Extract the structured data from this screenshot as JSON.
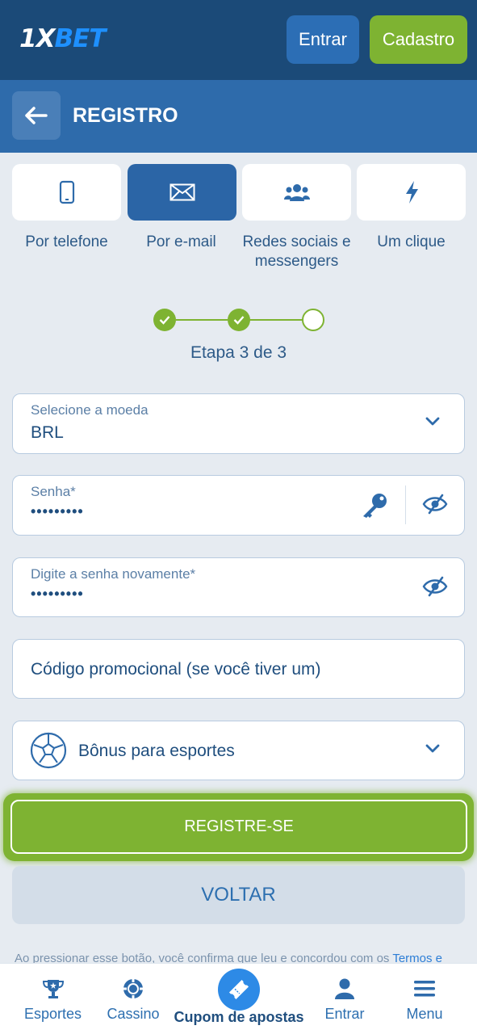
{
  "topbar": {
    "logo_prefix": "1X",
    "logo_suffix": "BET",
    "login_label": "Entrar",
    "signup_label": "Cadastro"
  },
  "header": {
    "title": "REGISTRO"
  },
  "methods": [
    {
      "label": "Por telefone",
      "icon": "phone-icon",
      "active": false
    },
    {
      "label": "Por e-mail",
      "icon": "envelope-icon",
      "active": true
    },
    {
      "label": "Redes sociais e messengers",
      "icon": "users-icon",
      "active": false
    },
    {
      "label": "Um clique",
      "icon": "lightning-icon",
      "active": false
    }
  ],
  "steps": {
    "current": 3,
    "total": 3,
    "label": "Etapa 3 de 3"
  },
  "form": {
    "currency_label": "Selecione a moeda",
    "currency_value": "BRL",
    "password_label": "Senha*",
    "password_value": "•••••••••",
    "password_repeat_label": "Digite a senha novamente*",
    "password_repeat_value": "•••••••••",
    "promo_placeholder": "Código promocional (se você tiver um)",
    "bonus_label": "Bônus para esportes"
  },
  "buttons": {
    "register_label": "REGISTRE-SE",
    "back_label": "VOLTAR"
  },
  "terms": {
    "text": "Ao pressionar esse botão, você confirma que leu e concordou com os ",
    "link": "Termos e"
  },
  "bottom_nav": {
    "sports": "Esportes",
    "casino": "Cassino",
    "coupon": "Cupom de apostas",
    "login": "Entrar",
    "menu": "Menu"
  },
  "colors": {
    "topbar": "#1b4a78",
    "header": "#2e6bab",
    "accent_green": "#7eb332",
    "text_blue": "#2d5a88"
  }
}
